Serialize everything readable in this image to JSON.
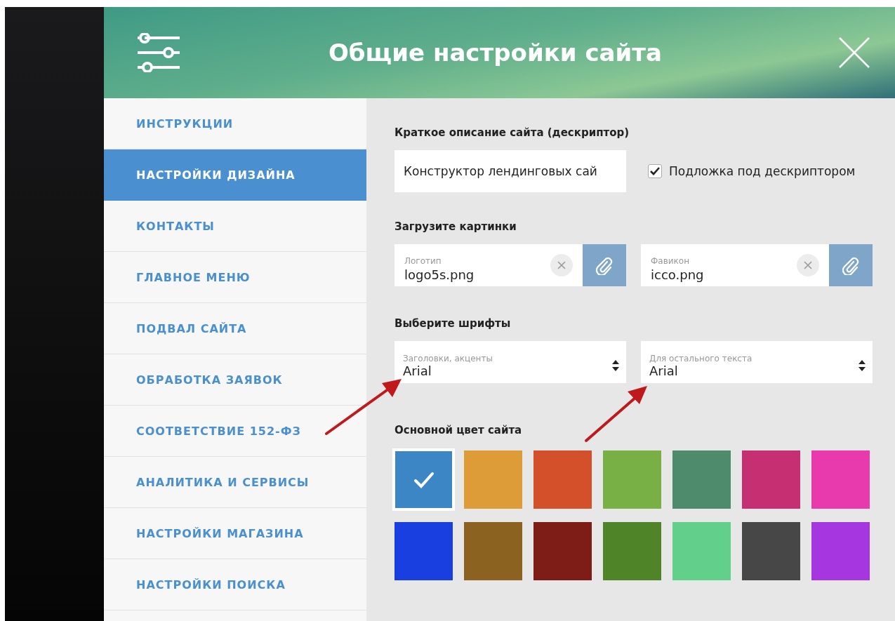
{
  "window": {
    "title": "Общие настройки сайта"
  },
  "sidebar": {
    "items": [
      {
        "label": "ИНСТРУКЦИИ",
        "selected": false
      },
      {
        "label": "НАСТРОЙКИ ДИЗАЙНА",
        "selected": true
      },
      {
        "label": "КОНТАКТЫ",
        "selected": false
      },
      {
        "label": "ГЛАВНОЕ МЕНЮ",
        "selected": false
      },
      {
        "label": "ПОДВАЛ САЙТА",
        "selected": false
      },
      {
        "label": "ОБРАБОТКА ЗАЯВОК",
        "selected": false
      },
      {
        "label": "СООТВЕТСТВИЕ 152-ФЗ",
        "selected": false
      },
      {
        "label": "АНАЛИТИКА И СЕРВИСЫ",
        "selected": false
      },
      {
        "label": "НАСТРОЙКИ МАГАЗИНА",
        "selected": false
      },
      {
        "label": "НАСТРОЙКИ ПОИСКА",
        "selected": false
      }
    ]
  },
  "descriptor": {
    "label": "Краткое описание сайта (дескриптор)",
    "value": "Конструктор лендинговых сай",
    "checkbox": {
      "label": "Подложка под дескриптором",
      "checked": true
    }
  },
  "images": {
    "label": "Загрузите картинки",
    "fields": [
      {
        "label": "Логотип",
        "value": "logo5s.png"
      },
      {
        "label": "Фавикон",
        "value": "icco.png"
      }
    ]
  },
  "fonts": {
    "label": "Выберите шрифты",
    "selects": [
      {
        "label": "Заголовки, акценты",
        "value": "Arial"
      },
      {
        "label": "Для остального текста",
        "value": "Arial"
      }
    ]
  },
  "main_color": {
    "label": "Основной цвет сайта",
    "swatches": [
      {
        "color": "#3d86c6",
        "selected": true
      },
      {
        "color": "#dd9c38",
        "selected": false
      },
      {
        "color": "#d4502a",
        "selected": false
      },
      {
        "color": "#79b046",
        "selected": false
      },
      {
        "color": "#4e8a6c",
        "selected": false
      },
      {
        "color": "#c62f72",
        "selected": false
      },
      {
        "color": "#e83aad",
        "selected": false
      },
      {
        "color": "#1a3fe0",
        "selected": false
      },
      {
        "color": "#8b6220",
        "selected": false
      },
      {
        "color": "#7e1c18",
        "selected": false
      },
      {
        "color": "#4f8528",
        "selected": false
      },
      {
        "color": "#62d08a",
        "selected": false
      },
      {
        "color": "#474747",
        "selected": false
      },
      {
        "color": "#a637e0",
        "selected": false
      }
    ]
  }
}
